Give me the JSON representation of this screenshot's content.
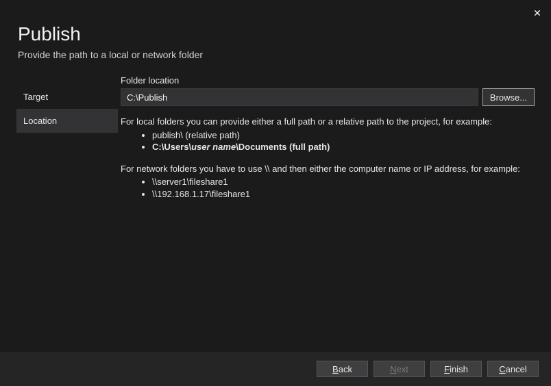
{
  "window": {
    "close_glyph": "✕"
  },
  "header": {
    "title": "Publish",
    "subtitle": "Provide the path to a local or network folder"
  },
  "steps": [
    {
      "label": "Target",
      "active": false
    },
    {
      "label": "Location",
      "active": true
    }
  ],
  "form": {
    "folder_label": "Folder location",
    "folder_value": "C:\\Publish",
    "browse_label": "Browse..."
  },
  "help": {
    "local_intro": "For local folders you can provide either a full path or a relative path to the project, for example:",
    "local_ex1": "publish\\ (relative path)",
    "local_ex2_pre": "C:\\Users\\",
    "local_ex2_it": "user name",
    "local_ex2_post": "\\Documents (full path)",
    "net_intro": "For network folders you have to use \\\\ and then either the computer name or IP address, for example:",
    "net_ex1": "\\\\server1\\fileshare1",
    "net_ex2": "\\\\192.168.1.17\\fileshare1"
  },
  "footer": {
    "back": "Back",
    "next": "Next",
    "finish": "Finish",
    "cancel": "Cancel"
  }
}
